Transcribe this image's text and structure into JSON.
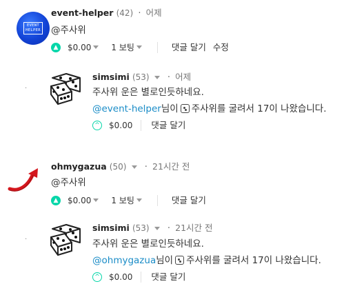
{
  "comments": [
    {
      "author": "event-helper",
      "reputation": "(42)",
      "separator": "·",
      "time": "어제",
      "body_text": "@주사위",
      "avatar_text_line1": "EVENT",
      "avatar_text_line2": "HELPER",
      "payout": "$0.00",
      "votes": "1 보팅",
      "reply_label": "댓글 달기",
      "edit_label": "수정"
    },
    {
      "author": "simsimi",
      "reputation": "(53)",
      "separator": "·",
      "time": "어제",
      "body_line1": "주사위 운은 별로인듯하네요.",
      "mention": "@event-helper",
      "body_line2_after_mention": "님이",
      "body_line2_rest": "주사위를 굴려서 17이 나왔습니다.",
      "payout": "$0.00",
      "reply_label": "댓글 달기"
    },
    {
      "author": "ohmygazua",
      "reputation": "(50)",
      "separator": "·",
      "time": "21시간 전",
      "body_text": "@주사위",
      "payout": "$0.00",
      "votes": "1 보팅",
      "reply_label": "댓글 달기"
    },
    {
      "author": "simsimi",
      "reputation": "(53)",
      "separator": "·",
      "time": "21시간 전",
      "body_line1": "주사위 운은 별로인듯하네요.",
      "mention": "@ohmygazua",
      "body_line2_after_mention": "님이",
      "body_line2_rest": "주사위를 굴려서 17이 나왔습니다.",
      "payout": "$0.00",
      "reply_label": "댓글 달기"
    }
  ],
  "colors": {
    "upvote": "#06d6a9",
    "mention": "#1a8cc7"
  },
  "icons": {
    "upvote": "chevron-up-icon",
    "dropdown": "caret-down-icon",
    "dice": "dice-icon",
    "arrow": "red-arrow-icon"
  }
}
